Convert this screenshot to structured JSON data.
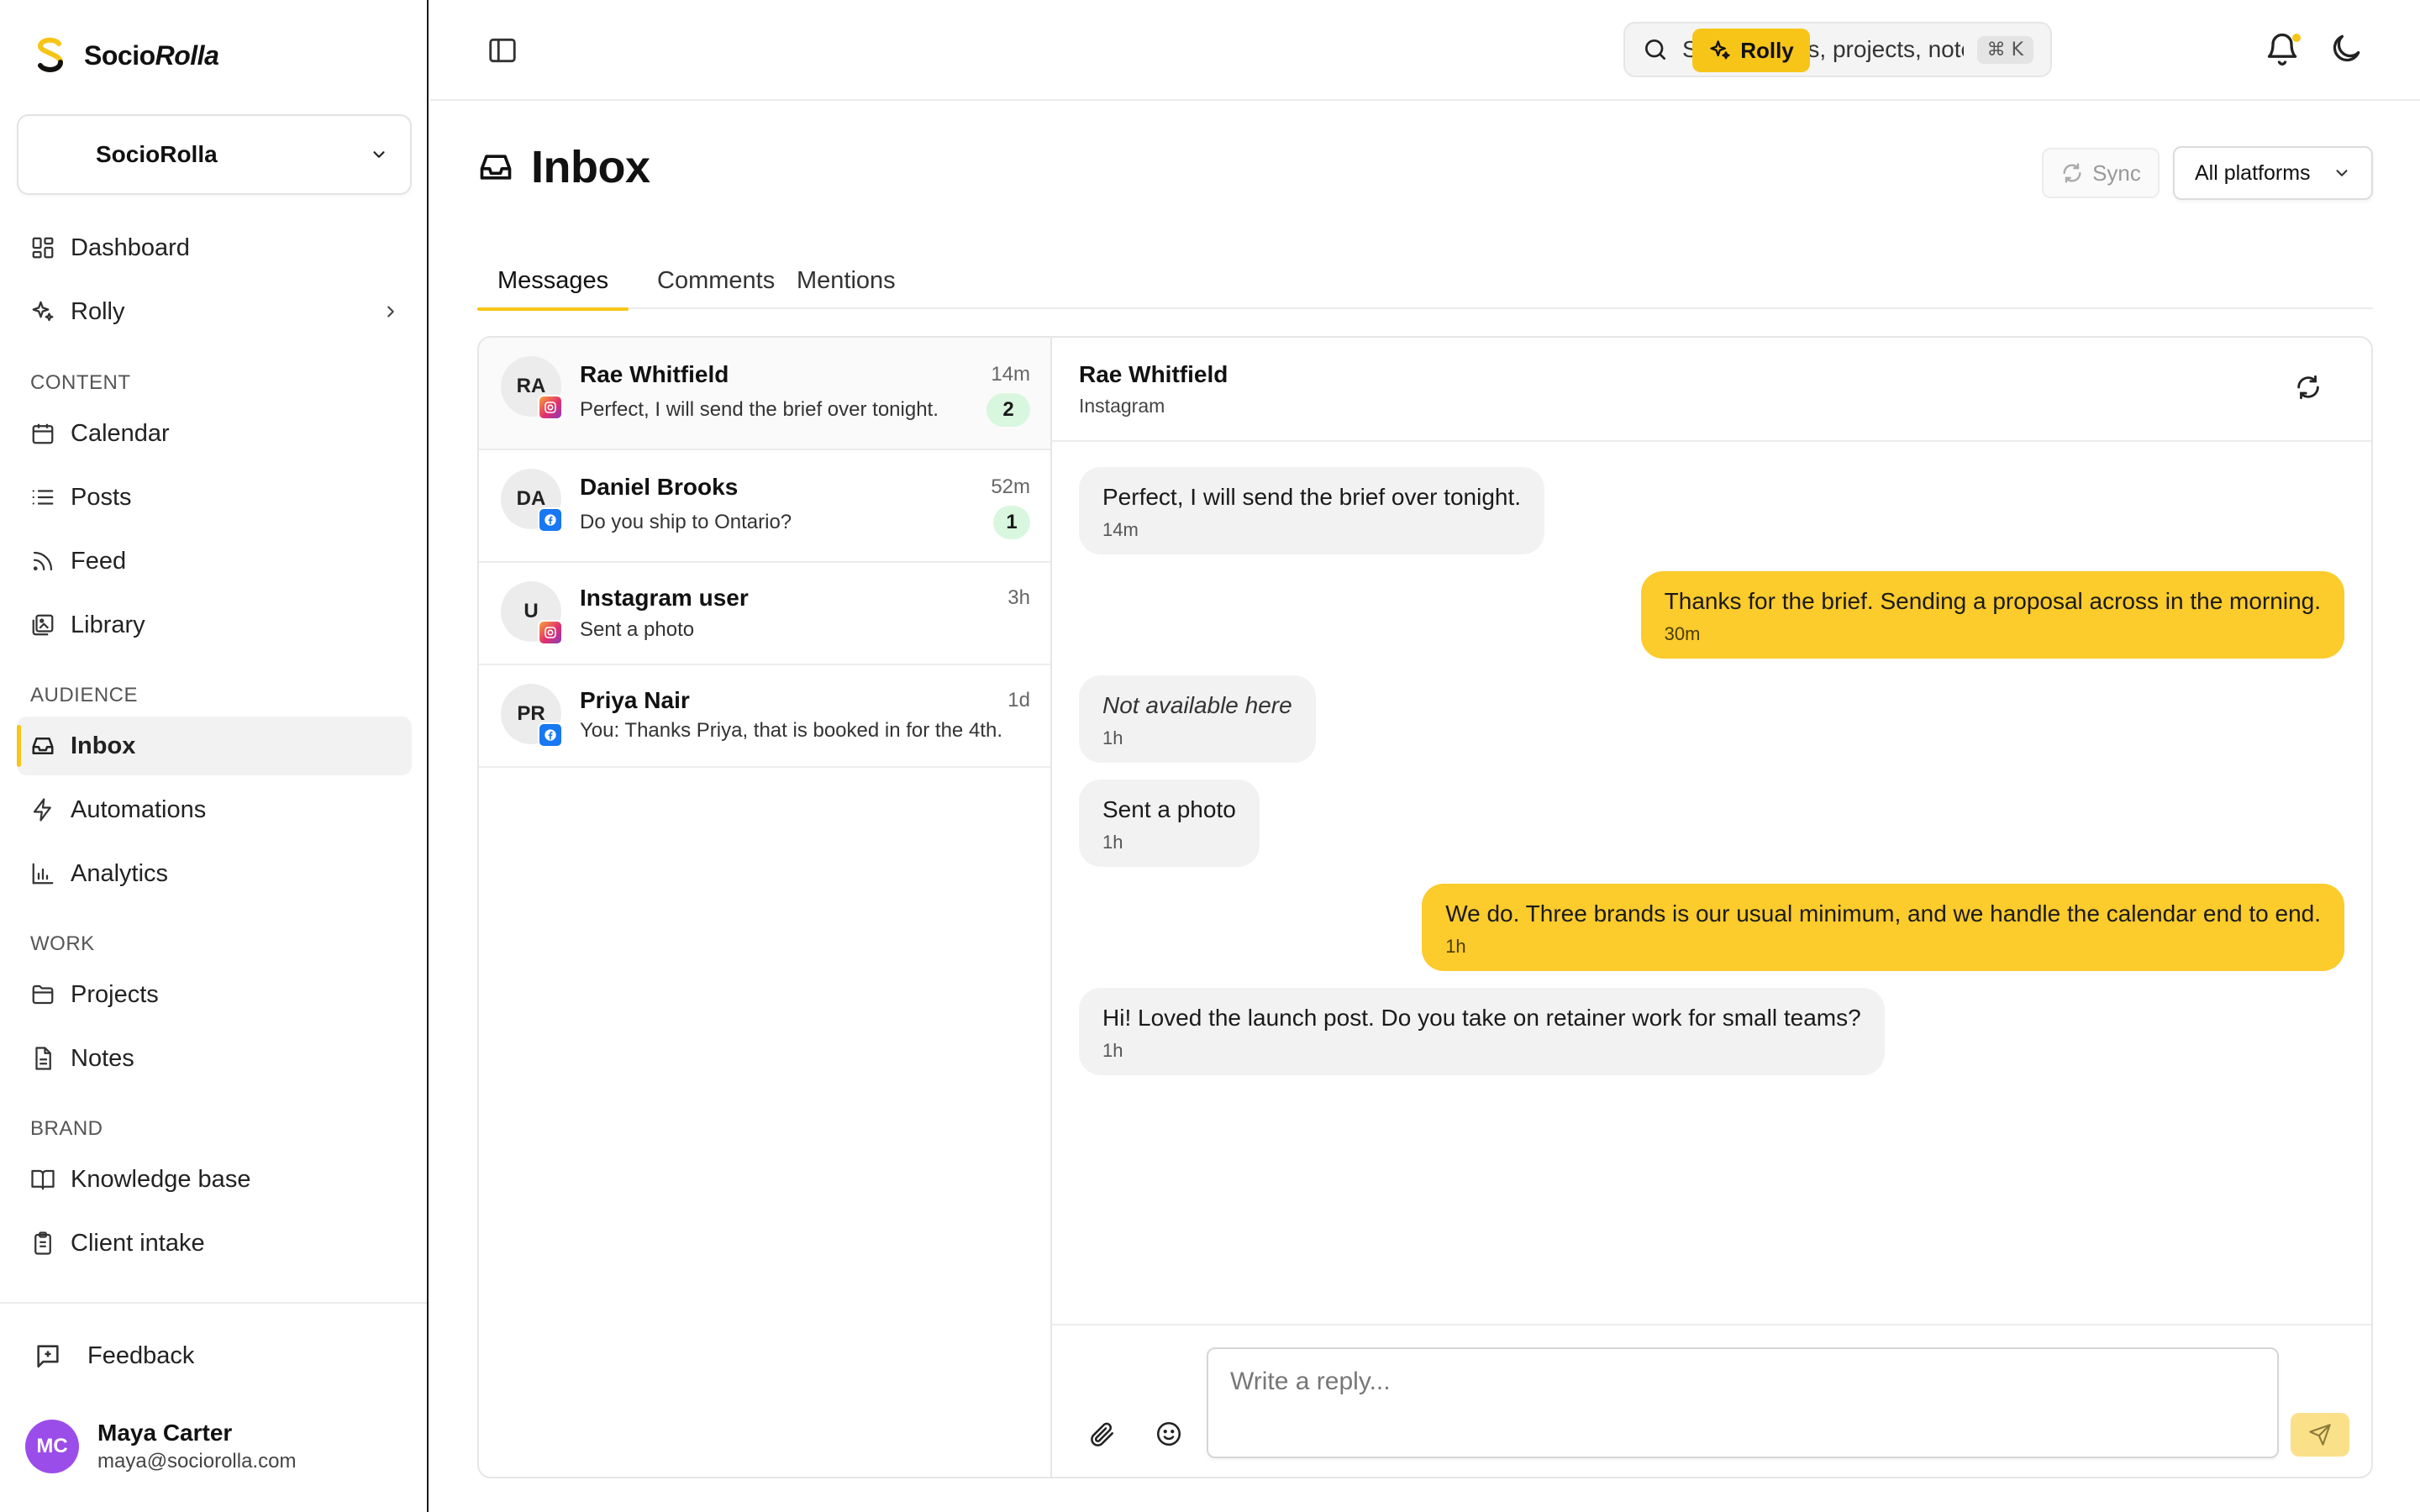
{
  "brand": {
    "name_plain": "Socio",
    "name_italic": "Rolla"
  },
  "workspace": {
    "name": "SocioRolla"
  },
  "nav": {
    "dashboard": "Dashboard",
    "rolly": "Rolly",
    "content_label": "CONTENT",
    "calendar": "Calendar",
    "posts": "Posts",
    "feed": "Feed",
    "library": "Library",
    "audience_label": "AUDIENCE",
    "inbox": "Inbox",
    "automations": "Automations",
    "analytics": "Analytics",
    "work_label": "WORK",
    "projects": "Projects",
    "notes": "Notes",
    "brand_label": "BRAND",
    "knowledge_base": "Knowledge base",
    "client_intake": "Client intake",
    "feedback": "Feedback"
  },
  "user": {
    "initials": "MC",
    "name": "Maya Carter",
    "email": "maya@sociorolla.com"
  },
  "topbar": {
    "search_placeholder": "Search posts, projects, notes...",
    "shortcut": "⌘ K",
    "rolly_label": "Rolly"
  },
  "page": {
    "title": "Inbox",
    "sync_label": "Sync",
    "platform_filter": "All platforms"
  },
  "tabs": [
    "Messages",
    "Comments",
    "Mentions"
  ],
  "conversations": [
    {
      "initials": "RA",
      "name": "Rae Whitfield",
      "preview": "Perfect, I will send the brief over tonight.",
      "time": "14m",
      "unread": "2",
      "platform": "instagram"
    },
    {
      "initials": "DA",
      "name": "Daniel Brooks",
      "preview": "Do you ship to Ontario?",
      "time": "52m",
      "unread": "1",
      "platform": "facebook"
    },
    {
      "initials": "U",
      "name": "Instagram user",
      "preview": "Sent a photo",
      "time": "3h",
      "platform": "instagram"
    },
    {
      "initials": "PR",
      "name": "Priya Nair",
      "preview": "You: Thanks Priya, that is booked in for the 4th.",
      "time": "1d",
      "platform": "facebook"
    }
  ],
  "thread": {
    "name": "Rae Whitfield",
    "platform": "Instagram",
    "messages": [
      {
        "direction": "in",
        "text": "Perfect, I will send the brief over tonight.",
        "time": "14m"
      },
      {
        "direction": "out",
        "text": "Thanks for the brief. Sending a proposal across in the morning.",
        "time": "30m"
      },
      {
        "direction": "in",
        "text": "Not available here",
        "time": "1h",
        "italic": true
      },
      {
        "direction": "in",
        "text": "Sent a photo",
        "time": "1h"
      },
      {
        "direction": "out",
        "text": "We do. Three brands is our usual minimum, and we handle the calendar end to end.",
        "time": "1h"
      },
      {
        "direction": "in",
        "text": "Hi! Loved the launch post. Do you take on retainer work for small teams?",
        "time": "1h"
      }
    ],
    "reply_placeholder": "Write a reply..."
  },
  "colors": {
    "accent": "#f7c518",
    "outgoing_bubble": "#fccb2c",
    "incoming_bubble": "#f2f2f2",
    "unread_badge": "#d9f7df",
    "avatar_user": "#9b4dea",
    "facebook": "#1877f2"
  }
}
